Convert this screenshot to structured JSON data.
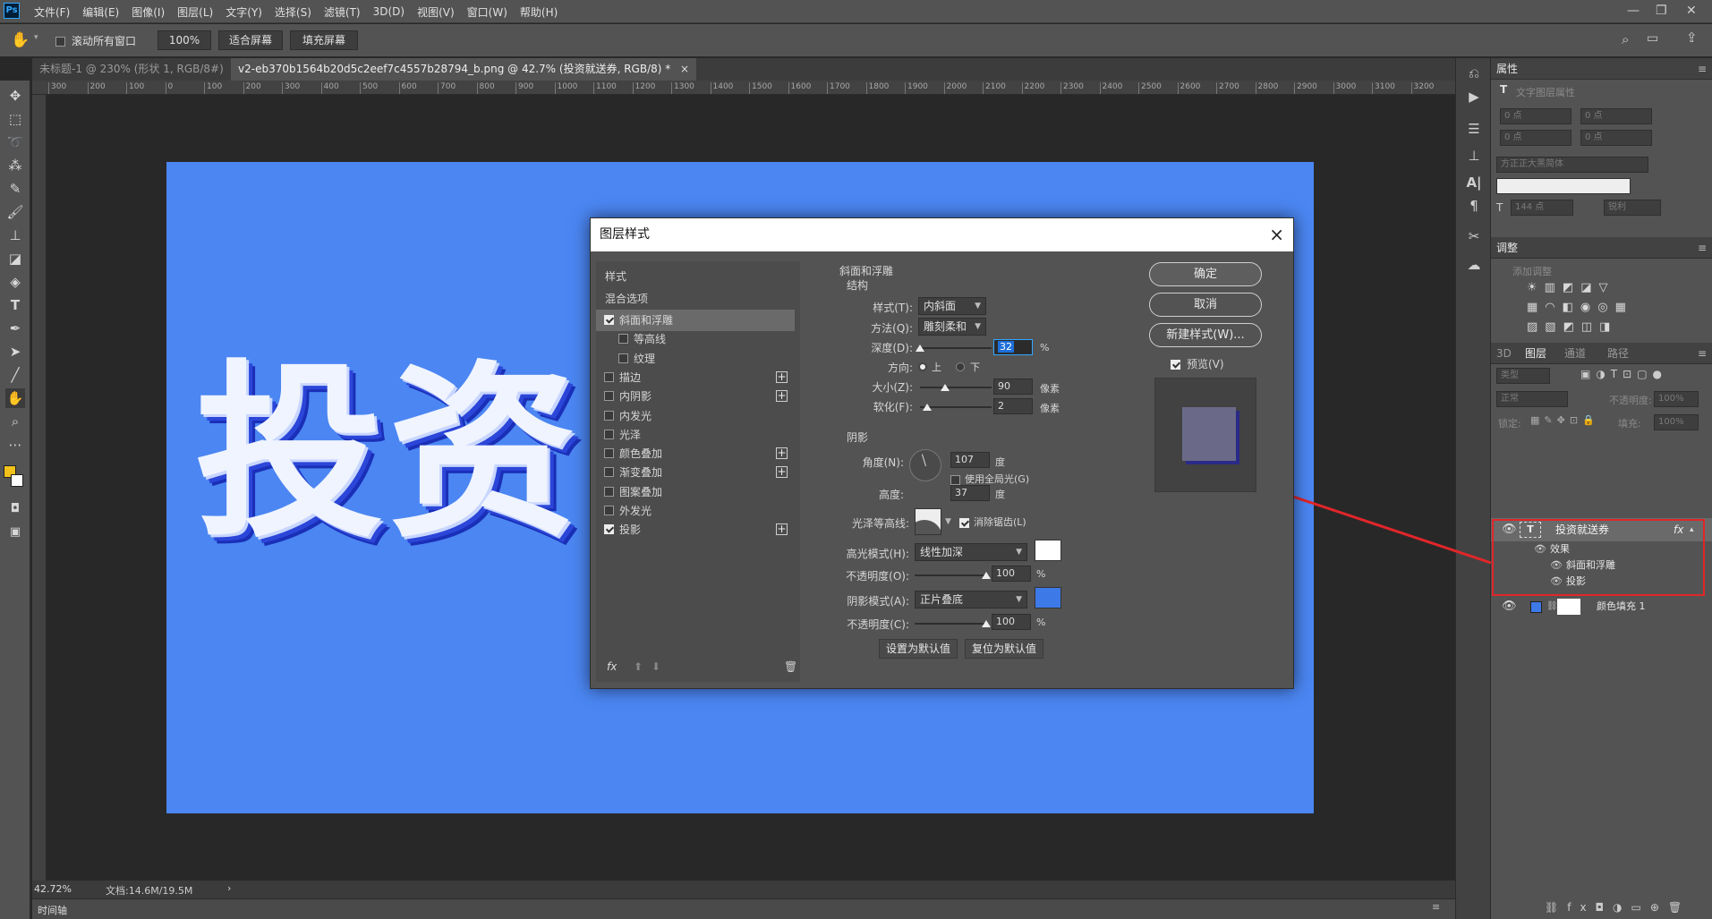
{
  "app": {
    "logo": "Ps"
  },
  "menu": [
    "文件(F)",
    "编辑(E)",
    "图像(I)",
    "图层(L)",
    "文字(Y)",
    "选择(S)",
    "滤镜(T)",
    "3D(D)",
    "视图(V)",
    "窗口(W)",
    "帮助(H)"
  ],
  "options": {
    "scroll_all_label": "滚动所有窗口",
    "zoom_value": "100%",
    "fit_screen": "适合屏幕",
    "fill_screen": "填充屏幕"
  },
  "tabs": [
    {
      "label": "未标题-1 @ 230% (形状 1, RGB/8#) *",
      "active": false
    },
    {
      "label": "v2-eb370b1564b20d5c2eef7c4557b28794_b.png @ 42.7% (投资就送券, RGB/8) *",
      "active": true
    }
  ],
  "ruler_ticks": [
    "300",
    "200",
    "100",
    "0",
    "100",
    "200",
    "300",
    "400",
    "500",
    "600",
    "700",
    "800",
    "900",
    "1000",
    "1100",
    "1200",
    "1300",
    "1400",
    "1500",
    "1600",
    "1700",
    "1800",
    "1900",
    "2000",
    "2100",
    "2200",
    "2300",
    "2400",
    "2500",
    "2600",
    "2700",
    "2800",
    "2900",
    "3000",
    "3100",
    "3200"
  ],
  "canvas": {
    "text": "投资",
    "bg_color": "#4b86f2"
  },
  "status": {
    "zoom": "42.72%",
    "doc": "文档:14.6M/19.5M",
    "arrow": "›"
  },
  "timeline": {
    "label": "时间轴"
  },
  "properties": {
    "title": "属性",
    "subtitle": "文字图层属性",
    "fields": [
      "0 点",
      "0 点",
      "0 点",
      "0 点"
    ],
    "font": "方正正大黑简体",
    "size": "144 点",
    "aa": "锐利"
  },
  "adjust": {
    "title": "调整",
    "subtitle": "添加调整"
  },
  "layers_panel": {
    "tabs": [
      "3D",
      "图层",
      "通道",
      "路径"
    ],
    "kind": "类型",
    "blend": "正常",
    "opacity_label": "不透明度:",
    "opacity": "100%",
    "lock_label": "锁定:",
    "fill_label": "填充:",
    "fill": "100%",
    "layers": [
      {
        "name": "投资就送券",
        "fx": "fx"
      },
      {
        "name": "效果"
      },
      {
        "name": "斜面和浮雕"
      },
      {
        "name": "投影"
      },
      {
        "name": "颜色填充 1"
      }
    ]
  },
  "dialog": {
    "title": "图层样式",
    "close": "×",
    "styles_header": "样式",
    "blend_options": "混合选项",
    "style_items": [
      {
        "label": "斜面和浮雕",
        "checked": true,
        "sel": true,
        "plus": false,
        "indent": false
      },
      {
        "label": "等高线",
        "checked": false,
        "sel": false,
        "plus": false,
        "indent": true
      },
      {
        "label": "纹理",
        "checked": false,
        "sel": false,
        "plus": false,
        "indent": true
      },
      {
        "label": "描边",
        "checked": false,
        "sel": false,
        "plus": true,
        "indent": false
      },
      {
        "label": "内阴影",
        "checked": false,
        "sel": false,
        "plus": true,
        "indent": false
      },
      {
        "label": "内发光",
        "checked": false,
        "sel": false,
        "plus": false,
        "indent": false
      },
      {
        "label": "光泽",
        "checked": false,
        "sel": false,
        "plus": false,
        "indent": false
      },
      {
        "label": "颜色叠加",
        "checked": false,
        "sel": false,
        "plus": true,
        "indent": false
      },
      {
        "label": "渐变叠加",
        "checked": false,
        "sel": false,
        "plus": true,
        "indent": false
      },
      {
        "label": "图案叠加",
        "checked": false,
        "sel": false,
        "plus": false,
        "indent": false
      },
      {
        "label": "外发光",
        "checked": false,
        "sel": false,
        "plus": false,
        "indent": false
      },
      {
        "label": "投影",
        "checked": true,
        "sel": false,
        "plus": true,
        "indent": false
      }
    ],
    "fx_label": "fx",
    "section_title": "斜面和浮雕",
    "structure": "结构",
    "style_label": "样式(T):",
    "style_value": "内斜面",
    "technique_label": "方法(Q):",
    "technique_value": "雕刻柔和",
    "depth_label": "深度(D):",
    "depth_value": "32",
    "depth_unit": "%",
    "depth_frac": 0.0,
    "direction_label": "方向:",
    "dir_up": "上",
    "dir_down": "下",
    "size_label": "大小(Z):",
    "size_value": "90",
    "size_unit": "像素",
    "size_frac": 0.35,
    "soften_label": "软化(F):",
    "soften_value": "2",
    "soften_unit": "像素",
    "soften_frac": 0.1,
    "shading": "阴影",
    "angle_label": "角度(N):",
    "angle_value": "107",
    "angle_unit": "度",
    "global_light": "使用全局光(G)",
    "altitude_label": "高度:",
    "altitude_value": "37",
    "altitude_unit": "度",
    "gloss_label": "光泽等高线:",
    "antialias": "消除锯齿(L)",
    "hl_mode_label": "高光模式(H):",
    "hl_mode": "线性加深",
    "hl_color": "#ffffff",
    "hl_opacity_label": "不透明度(O):",
    "hl_opacity": "100",
    "pct": "%",
    "sh_mode_label": "阴影模式(A):",
    "sh_mode": "正片叠底",
    "sh_color": "#3d7ae8",
    "sh_opacity_label": "不透明度(C):",
    "sh_opacity": "100",
    "make_default": "设置为默认值",
    "reset_default": "复位为默认值",
    "ok": "确定",
    "cancel": "取消",
    "new_style": "新建样式(W)...",
    "preview": "预览(V)"
  },
  "colors": {
    "annotation_red": "#e0262a",
    "accent_blue": "#31a8ff"
  }
}
